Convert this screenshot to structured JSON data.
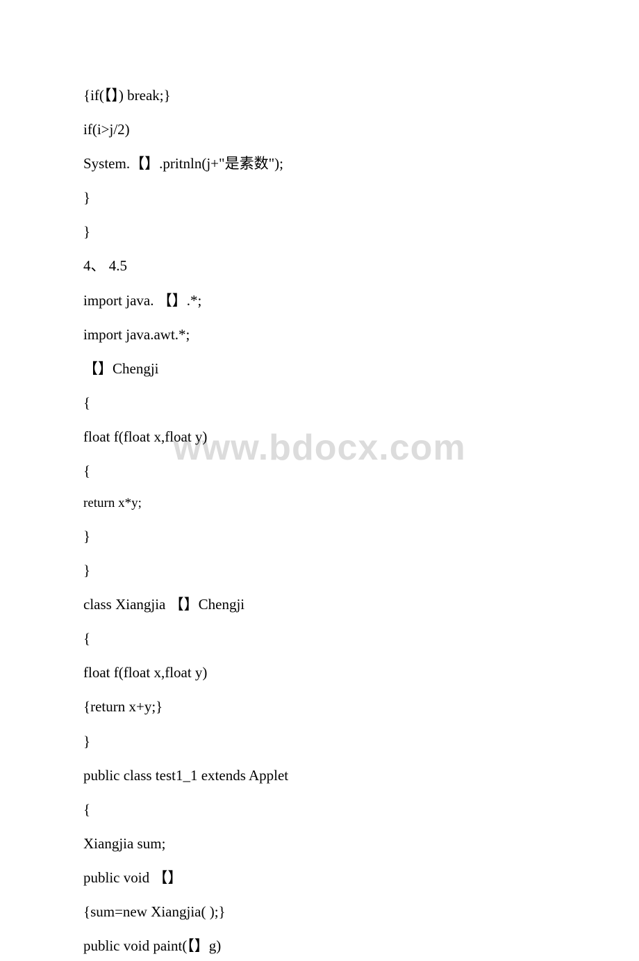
{
  "watermark": "www.bdocx.com",
  "lines": [
    " {if(【】) break;}",
    "if(i>j/2)",
    "System.【】.pritnln(j+\"是素数\");",
    "}",
    "}",
    "4、 4.5",
    "import java. 【】.*;",
    "import java.awt.*;",
    "【】Chengji",
    "{",
    " float f(float x,float y)",
    " {",
    "return x*y;",
    "}",
    "}",
    "class Xiangjia 【】Chengji",
    "{",
    " float f(float x,float y)",
    " {return x+y;}",
    "}",
    "public class test1_1 extends Applet",
    "{",
    " Xiangjia sum;",
    " public void 【】",
    " {sum=new Xiangjia( );}",
    " public void paint(【】g)"
  ]
}
